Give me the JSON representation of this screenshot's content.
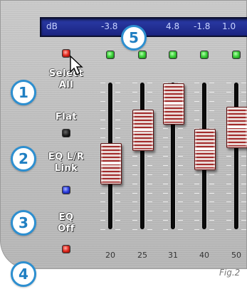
{
  "display": {
    "unit": "dB",
    "values": [
      "-3.8",
      "4.8",
      "-1.8",
      "1.0"
    ]
  },
  "left_panel": {
    "select_all": "Select\nAll",
    "flat": "Flat",
    "eq_link": "EQ L/R\nLink",
    "eq_off": "EQ\nOff"
  },
  "bands": [
    {
      "freq": "20",
      "level_fraction": 0.45
    },
    {
      "freq": "25",
      "level_fraction": 0.68
    },
    {
      "freq": "31",
      "level_fraction": 0.86
    },
    {
      "freq": "40",
      "level_fraction": 0.55
    },
    {
      "freq": "50",
      "level_fraction": 0.7
    }
  ],
  "callouts": [
    "1",
    "2",
    "3",
    "4",
    "5"
  ],
  "caption": "Fig.2",
  "colors": {
    "display_bg": "#1f2b93",
    "led_green": "#41d63f",
    "led_red": "#e52b20",
    "led_blue": "#2e3fe0",
    "knob_red": "#a22a2a",
    "callout_blue": "#2d8fd0"
  }
}
